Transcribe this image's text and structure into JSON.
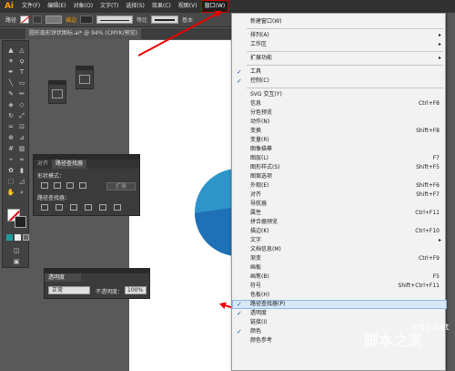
{
  "app": {
    "logo": "Ai"
  },
  "menubar": {
    "items": [
      "文件(F)",
      "编辑(E)",
      "对象(O)",
      "文字(T)",
      "选择(S)",
      "效果(C)",
      "视图(V)",
      "窗口(W)"
    ],
    "active_index": 7
  },
  "controlbar": {
    "label": "路径",
    "stroke_label": "描边",
    "stroke_type": "等比",
    "profile": "基本"
  },
  "document": {
    "tab": "圆形扇形饼状图标.ai* @ 94% (CMYK/预览)"
  },
  "colors": {
    "accent_orange": "#f7a000",
    "pie_light": "#2d95c9",
    "pie_dark": "#1f70b6",
    "arrow_red": "#e00000",
    "menu_highlight": "#d7e8f9"
  },
  "pathfinder": {
    "tabs": [
      "对齐",
      "路径查找器"
    ],
    "shape_modes_label": "形状模式：",
    "pathfinders_label": "路径查找器：",
    "expand_button": "扩展"
  },
  "transparency": {
    "tab": "透明度",
    "mode": "正常",
    "opacity_label": "不透明度：",
    "opacity": "100%"
  },
  "window_menu": {
    "items": [
      {
        "label": "新建窗口(W)",
        "shortcut": "",
        "checked": false,
        "submenu": false
      },
      {
        "sep": true
      },
      {
        "label": "排列(A)",
        "shortcut": "",
        "checked": false,
        "submenu": true
      },
      {
        "label": "工作区",
        "shortcut": "",
        "checked": false,
        "submenu": true
      },
      {
        "sep": true
      },
      {
        "label": "扩展功能",
        "shortcut": "",
        "checked": false,
        "submenu": true
      },
      {
        "sep": true
      },
      {
        "label": "工具",
        "shortcut": "",
        "checked": true,
        "submenu": false
      },
      {
        "label": "控制(C)",
        "shortcut": "",
        "checked": true,
        "submenu": false
      },
      {
        "sep": true
      },
      {
        "label": "SVG 交互(Y)",
        "shortcut": "",
        "checked": false,
        "submenu": false
      },
      {
        "label": "信息",
        "shortcut": "Ctrl+F8",
        "checked": false,
        "submenu": false
      },
      {
        "label": "分色预览",
        "shortcut": "",
        "checked": false,
        "submenu": false
      },
      {
        "label": "动作(N)",
        "shortcut": "",
        "checked": false,
        "submenu": false
      },
      {
        "label": "变换",
        "shortcut": "Shift+F8",
        "checked": false,
        "submenu": false
      },
      {
        "label": "变量(R)",
        "shortcut": "",
        "checked": false,
        "submenu": false
      },
      {
        "label": "图像描摹",
        "shortcut": "",
        "checked": false,
        "submenu": false
      },
      {
        "label": "图层(L)",
        "shortcut": "F7",
        "checked": false,
        "submenu": false
      },
      {
        "label": "图形样式(S)",
        "shortcut": "Shift+F5",
        "checked": false,
        "submenu": false
      },
      {
        "label": "图案选项",
        "shortcut": "",
        "checked": false,
        "submenu": false
      },
      {
        "label": "外观(E)",
        "shortcut": "Shift+F6",
        "checked": false,
        "submenu": false
      },
      {
        "label": "对齐",
        "shortcut": "Shift+F7",
        "checked": false,
        "submenu": false
      },
      {
        "label": "导航器",
        "shortcut": "",
        "checked": false,
        "submenu": false
      },
      {
        "label": "属性",
        "shortcut": "Ctrl+F11",
        "checked": false,
        "submenu": false
      },
      {
        "label": "拼合器预览",
        "shortcut": "",
        "checked": false,
        "submenu": false
      },
      {
        "label": "描边(K)",
        "shortcut": "Ctrl+F10",
        "checked": false,
        "submenu": false
      },
      {
        "label": "文字",
        "shortcut": "",
        "checked": false,
        "submenu": true
      },
      {
        "label": "文档信息(M)",
        "shortcut": "",
        "checked": false,
        "submenu": false
      },
      {
        "label": "渐变",
        "shortcut": "Ctrl+F9",
        "checked": false,
        "submenu": false
      },
      {
        "label": "画板",
        "shortcut": "",
        "checked": false,
        "submenu": false
      },
      {
        "label": "画笔(B)",
        "shortcut": "F5",
        "checked": false,
        "submenu": false
      },
      {
        "label": "符号",
        "shortcut": "Shift+Ctrl+F11",
        "checked": false,
        "submenu": false
      },
      {
        "label": "色板(H)",
        "shortcut": "",
        "checked": false,
        "submenu": false
      },
      {
        "label": "路径查找器(P)",
        "shortcut": "",
        "checked": true,
        "submenu": false,
        "highlight": true
      },
      {
        "label": "透明度",
        "shortcut": "",
        "checked": true,
        "submenu": false
      },
      {
        "label": "链接(I)",
        "shortcut": "",
        "checked": false,
        "submenu": false
      },
      {
        "label": "颜色",
        "shortcut": "",
        "checked": true,
        "submenu": false
      },
      {
        "label": "颜色参考",
        "shortcut": "",
        "checked": false,
        "submenu": false
      }
    ]
  },
  "watermark": {
    "text": "脚本之家",
    "url": "jb51.net"
  }
}
